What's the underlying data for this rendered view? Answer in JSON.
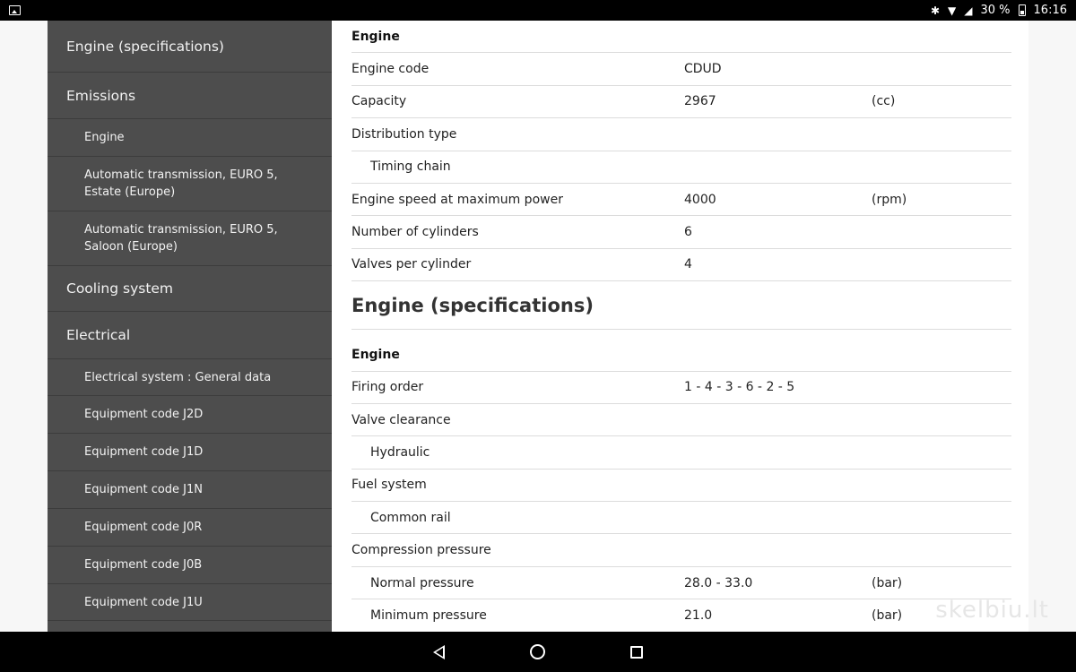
{
  "status_bar": {
    "battery_text": "30 %",
    "time": "16:16",
    "icons": [
      "image-icon",
      "bluetooth-icon",
      "wifi-icon",
      "signal-off-icon",
      "battery-icon"
    ]
  },
  "sidebar": {
    "items": [
      {
        "label": "Engine (specifications)",
        "level": "top"
      },
      {
        "label": "Emissions",
        "level": "top"
      },
      {
        "label": "Engine",
        "level": "sub"
      },
      {
        "label": "Automatic transmission, EURO 5, Estate (Europe)",
        "level": "sub"
      },
      {
        "label": "Automatic transmission, EURO 5, Saloon (Europe)",
        "level": "sub"
      },
      {
        "label": "Cooling system",
        "level": "top"
      },
      {
        "label": "Electrical",
        "level": "top"
      },
      {
        "label": "Electrical system : General data",
        "level": "sub"
      },
      {
        "label": "Equipment code J2D",
        "level": "sub"
      },
      {
        "label": "Equipment code J1D",
        "level": "sub"
      },
      {
        "label": "Equipment code J1N",
        "level": "sub"
      },
      {
        "label": "Equipment code J0R",
        "level": "sub"
      },
      {
        "label": "Equipment code J0B",
        "level": "sub"
      },
      {
        "label": "Equipment code J1U",
        "level": "sub"
      }
    ]
  },
  "content": {
    "section1": {
      "heading": "Engine",
      "rows": [
        {
          "label": "Engine code",
          "value": "CDUD",
          "unit": ""
        },
        {
          "label": "Capacity",
          "value": "2967",
          "unit": "(cc)"
        },
        {
          "label": "Distribution type",
          "value": "",
          "unit": ""
        },
        {
          "label": "Timing chain",
          "value": "",
          "unit": ""
        },
        {
          "label": "Engine speed at maximum power",
          "value": "4000",
          "unit": "(rpm)"
        },
        {
          "label": "Number of cylinders",
          "value": "6",
          "unit": ""
        },
        {
          "label": "Valves per cylinder",
          "value": "4",
          "unit": ""
        }
      ]
    },
    "title2": "Engine (specifications)",
    "section2": {
      "heading": "Engine",
      "rows": [
        {
          "label": "Firing order",
          "value": "1 - 4 - 3 - 6 - 2 - 5",
          "unit": ""
        },
        {
          "label": "Valve clearance",
          "value": "",
          "unit": ""
        },
        {
          "label": "Hydraulic",
          "value": "",
          "unit": ""
        },
        {
          "label": "Fuel system",
          "value": "",
          "unit": ""
        },
        {
          "label": "Common rail",
          "value": "",
          "unit": ""
        },
        {
          "label": "Compression pressure",
          "value": "",
          "unit": ""
        },
        {
          "label": "Normal pressure",
          "value": "28.0 - 33.0",
          "unit": "(bar)"
        },
        {
          "label": "Minimum pressure",
          "value": "21.0",
          "unit": "(bar)"
        }
      ]
    }
  },
  "watermark": "skelbiu.lt",
  "nav_bar": {
    "icons": [
      "back-icon",
      "home-icon",
      "recents-icon"
    ]
  }
}
